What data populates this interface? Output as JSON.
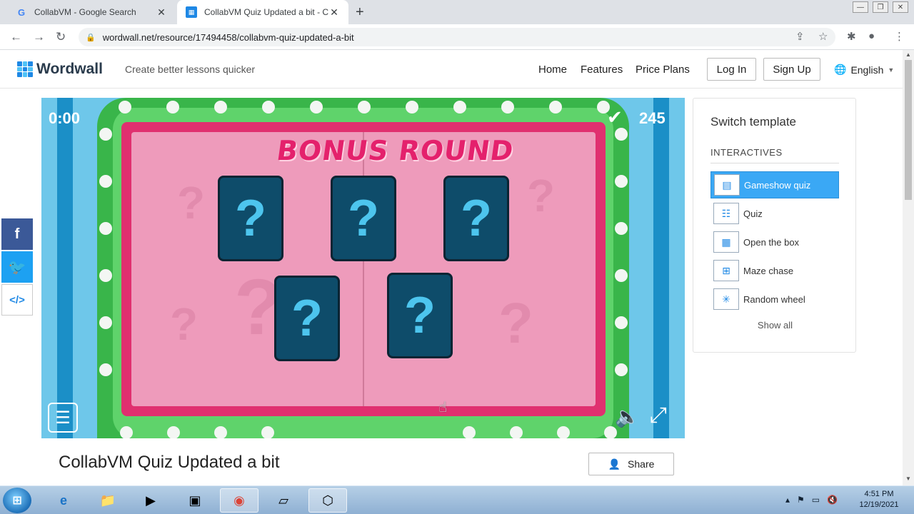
{
  "browser": {
    "tabs": [
      {
        "title": "CollabVM - Google Search",
        "icon": "google-icon"
      },
      {
        "title": "CollabVM Quiz Updated a bit - C",
        "icon": "wordwall-icon"
      }
    ],
    "url": "wordwall.net/resource/17494458/collabvm-quiz-updated-a-bit"
  },
  "header": {
    "logo": "Wordwall",
    "tagline": "Create better lessons quicker",
    "nav": [
      "Home",
      "Features",
      "Price Plans"
    ],
    "login": "Log In",
    "signup": "Sign Up",
    "language": "English"
  },
  "game": {
    "timer": "0:00",
    "score": "245",
    "title": "BONUS ROUND",
    "card_symbol": "?",
    "card_count": 5
  },
  "panel": {
    "title": "Switch template",
    "section": "INTERACTIVES",
    "templates": [
      {
        "label": "Gameshow quiz",
        "active": true,
        "icon": "gameshow-icon"
      },
      {
        "label": "Quiz",
        "active": false,
        "icon": "quiz-icon"
      },
      {
        "label": "Open the box",
        "active": false,
        "icon": "box-icon"
      },
      {
        "label": "Maze chase",
        "active": false,
        "icon": "maze-icon"
      },
      {
        "label": "Random wheel",
        "active": false,
        "icon": "wheel-icon"
      }
    ],
    "show_all": "Show all"
  },
  "activity": {
    "title": "CollabVM Quiz Updated a bit",
    "share": "Share"
  },
  "taskbar": {
    "time": "4:51 PM",
    "date": "12/19/2021"
  },
  "colors": {
    "accent": "#3aa8f5",
    "board_pink": "#e0306f",
    "card_blue": "#0e4c6a"
  }
}
